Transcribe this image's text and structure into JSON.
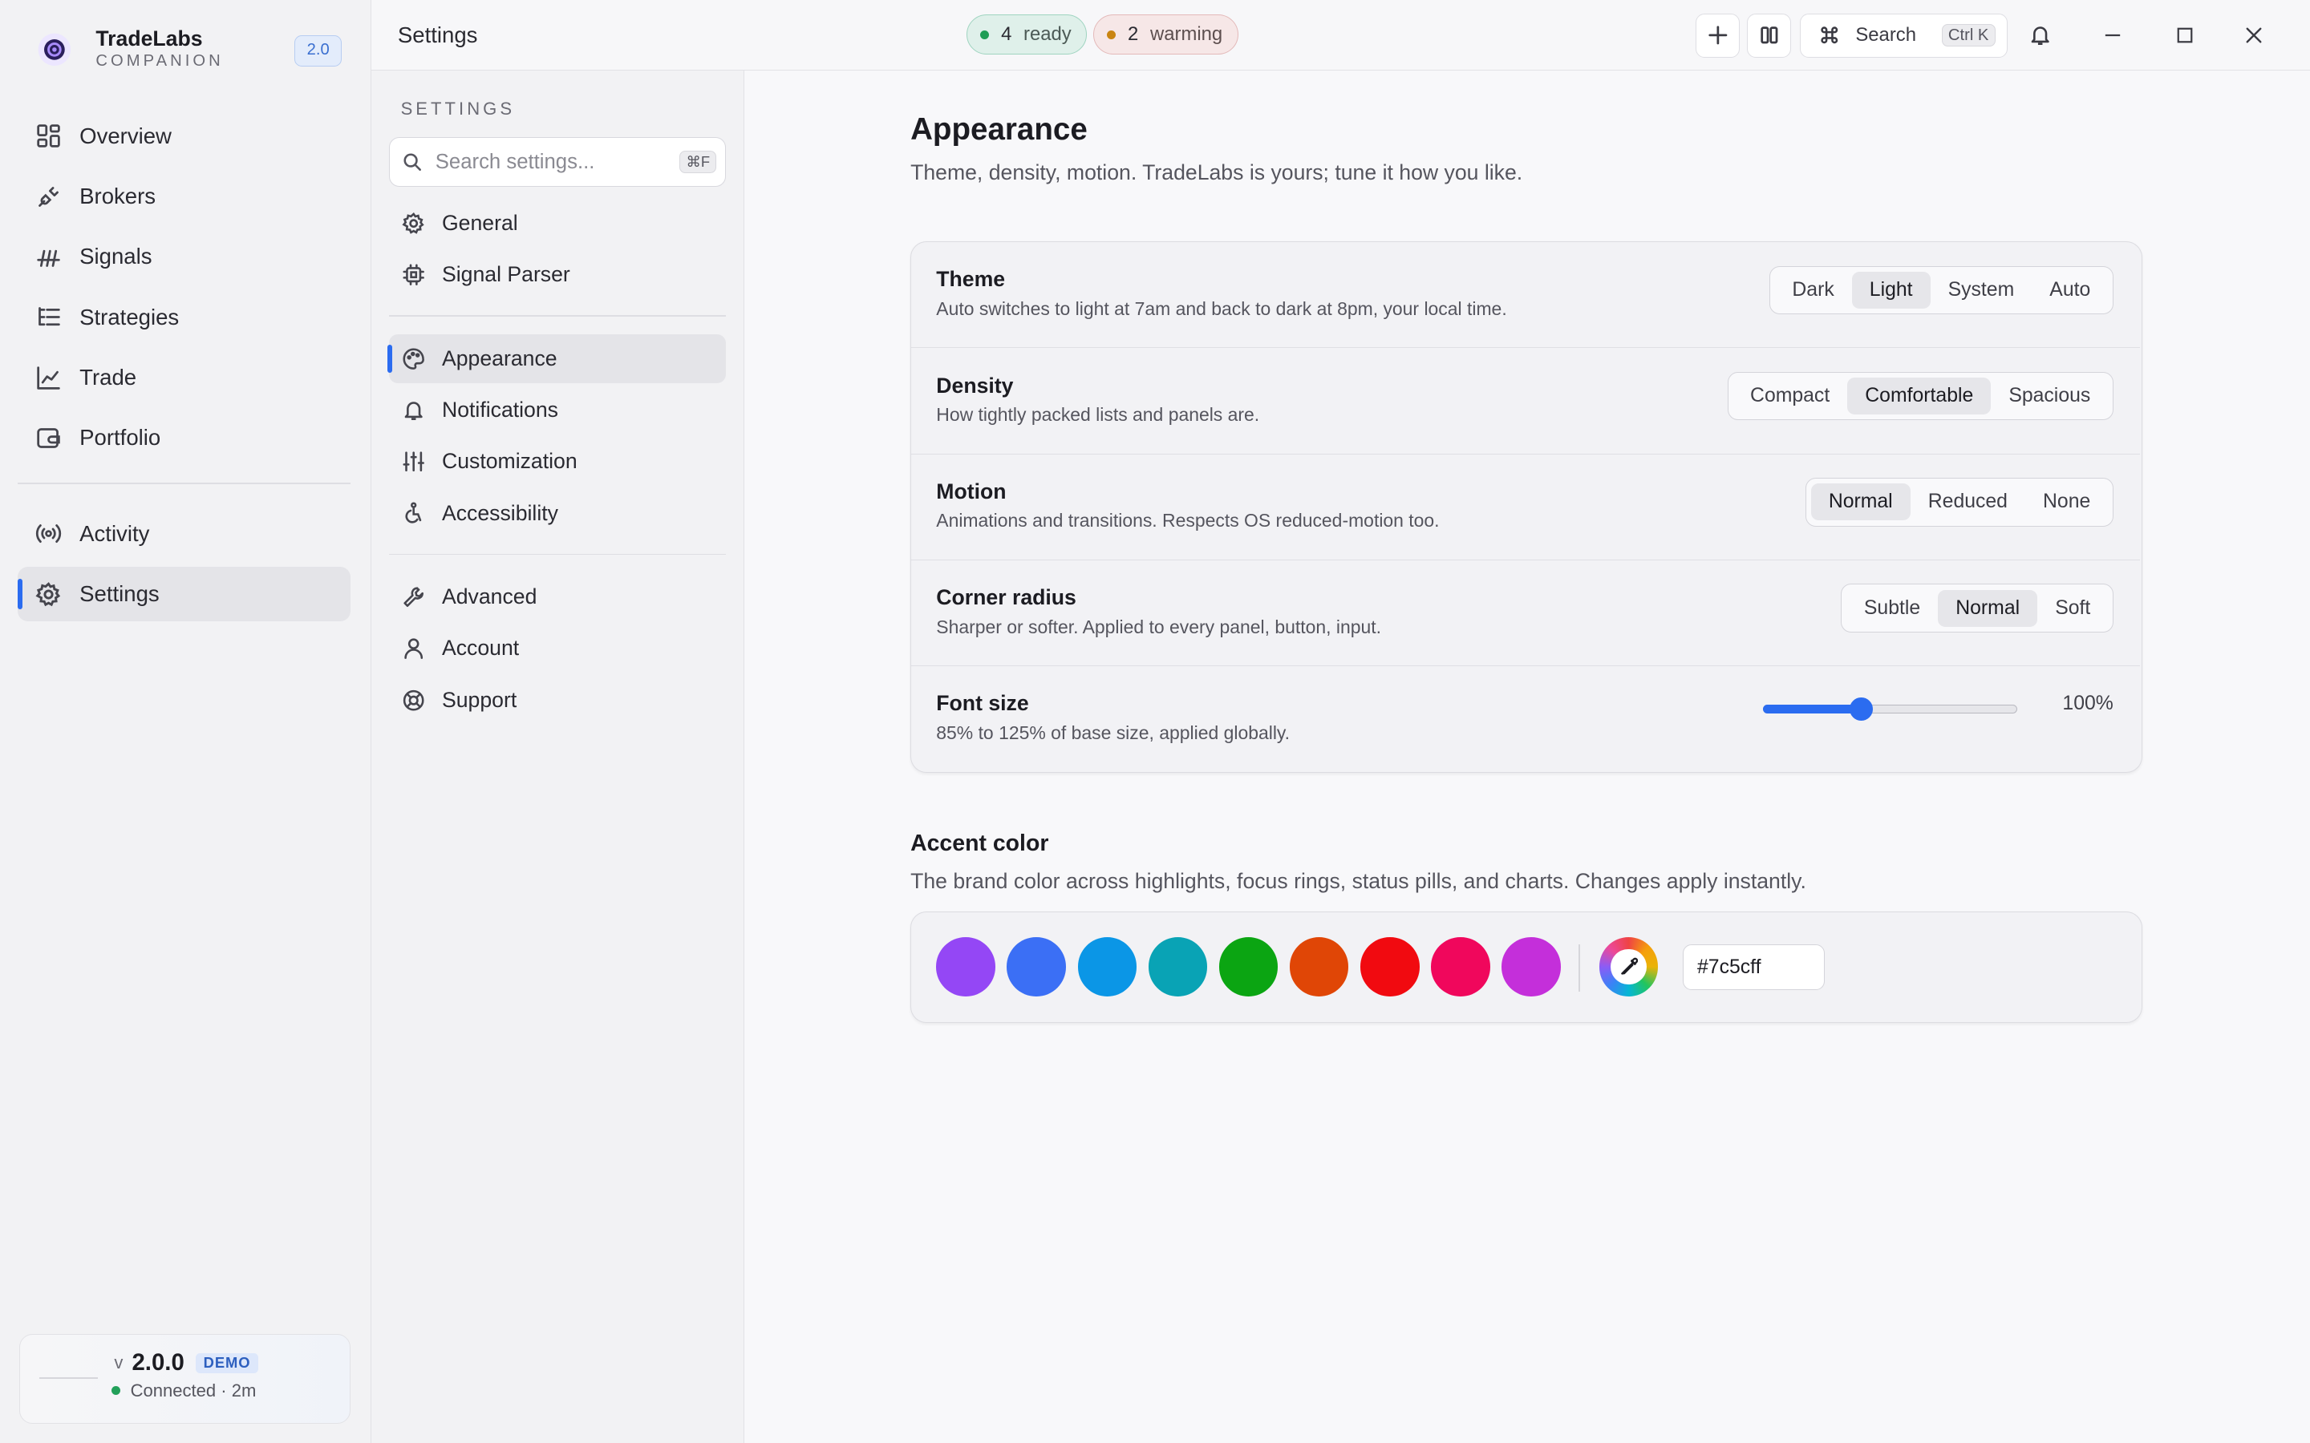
{
  "app": {
    "name": "TradeLabs",
    "subtitle": "COMPANION",
    "version_badge": "2.0"
  },
  "sidebar": {
    "items": [
      {
        "label": "Overview",
        "icon": "grid-icon"
      },
      {
        "label": "Brokers",
        "icon": "plug-icon"
      },
      {
        "label": "Signals",
        "icon": "signal-icon"
      },
      {
        "label": "Strategies",
        "icon": "list-tree-icon"
      },
      {
        "label": "Trade",
        "icon": "chart-line-icon"
      },
      {
        "label": "Portfolio",
        "icon": "wallet-icon"
      }
    ],
    "items2": [
      {
        "label": "Activity",
        "icon": "broadcast-icon"
      },
      {
        "label": "Settings",
        "icon": "gear-icon",
        "active": true
      }
    ],
    "status": {
      "v_prefix": "v",
      "version": "2.0.0",
      "badge": "DEMO",
      "connection": "Connected · 2m",
      "connected_color": "#22a05a"
    }
  },
  "topbar": {
    "title": "Settings",
    "ready_count": "4",
    "ready_label": "ready",
    "ready_color": "#1f9d55",
    "warming_count": "2",
    "warming_label": "warming",
    "warming_color": "#c98512",
    "search_label": "Search",
    "search_shortcut": "Ctrl K"
  },
  "settings_nav": {
    "header": "SETTINGS",
    "search_placeholder": "Search settings...",
    "search_shortcut": "⌘F",
    "group1": [
      {
        "label": "General",
        "icon": "gear-icon"
      },
      {
        "label": "Signal Parser",
        "icon": "cpu-icon"
      }
    ],
    "group2": [
      {
        "label": "Appearance",
        "icon": "palette-icon",
        "active": true
      },
      {
        "label": "Notifications",
        "icon": "bell-icon"
      },
      {
        "label": "Customization",
        "icon": "sliders-icon"
      },
      {
        "label": "Accessibility",
        "icon": "accessibility-icon"
      }
    ],
    "group3": [
      {
        "label": "Advanced",
        "icon": "wrench-icon"
      },
      {
        "label": "Account",
        "icon": "user-icon"
      },
      {
        "label": "Support",
        "icon": "lifebuoy-icon"
      }
    ]
  },
  "appearance": {
    "title": "Appearance",
    "subtitle": "Theme, density, motion. TradeLabs is yours; tune it how you like.",
    "theme": {
      "label": "Theme",
      "desc": "Auto switches to light at 7am and back to dark at 8pm, your local time.",
      "options": [
        "Dark",
        "Light",
        "System",
        "Auto"
      ],
      "selected": "Light"
    },
    "density": {
      "label": "Density",
      "desc": "How tightly packed lists and panels are.",
      "options": [
        "Compact",
        "Comfortable",
        "Spacious"
      ],
      "selected": "Comfortable"
    },
    "motion": {
      "label": "Motion",
      "desc": "Animations and transitions. Respects OS reduced-motion too.",
      "options": [
        "Normal",
        "Reduced",
        "None"
      ],
      "selected": "Normal"
    },
    "radius": {
      "label": "Corner radius",
      "desc": "Sharper or softer. Applied to every panel, button, input.",
      "options": [
        "Subtle",
        "Normal",
        "Soft"
      ],
      "selected": "Normal"
    },
    "font_size": {
      "label": "Font size",
      "desc": "85% to 125% of base size, applied globally.",
      "value_text": "100%",
      "value": 100,
      "min": 85,
      "max": 125
    }
  },
  "accent": {
    "title": "Accent color",
    "subtitle": "The brand color across highlights, focus rings, status pills, and charts. Changes apply instantly.",
    "swatches": [
      "#9447f5",
      "#3b6ff5",
      "#0b96e6",
      "#09a3b5",
      "#0ba512",
      "#e04606",
      "#f10a10",
      "#f0075c",
      "#c42fda"
    ],
    "hex_value": "#7c5cff",
    "picker_icon": "eyedropper-icon"
  },
  "colors": {
    "accent_ui": "#2b6cf0"
  }
}
